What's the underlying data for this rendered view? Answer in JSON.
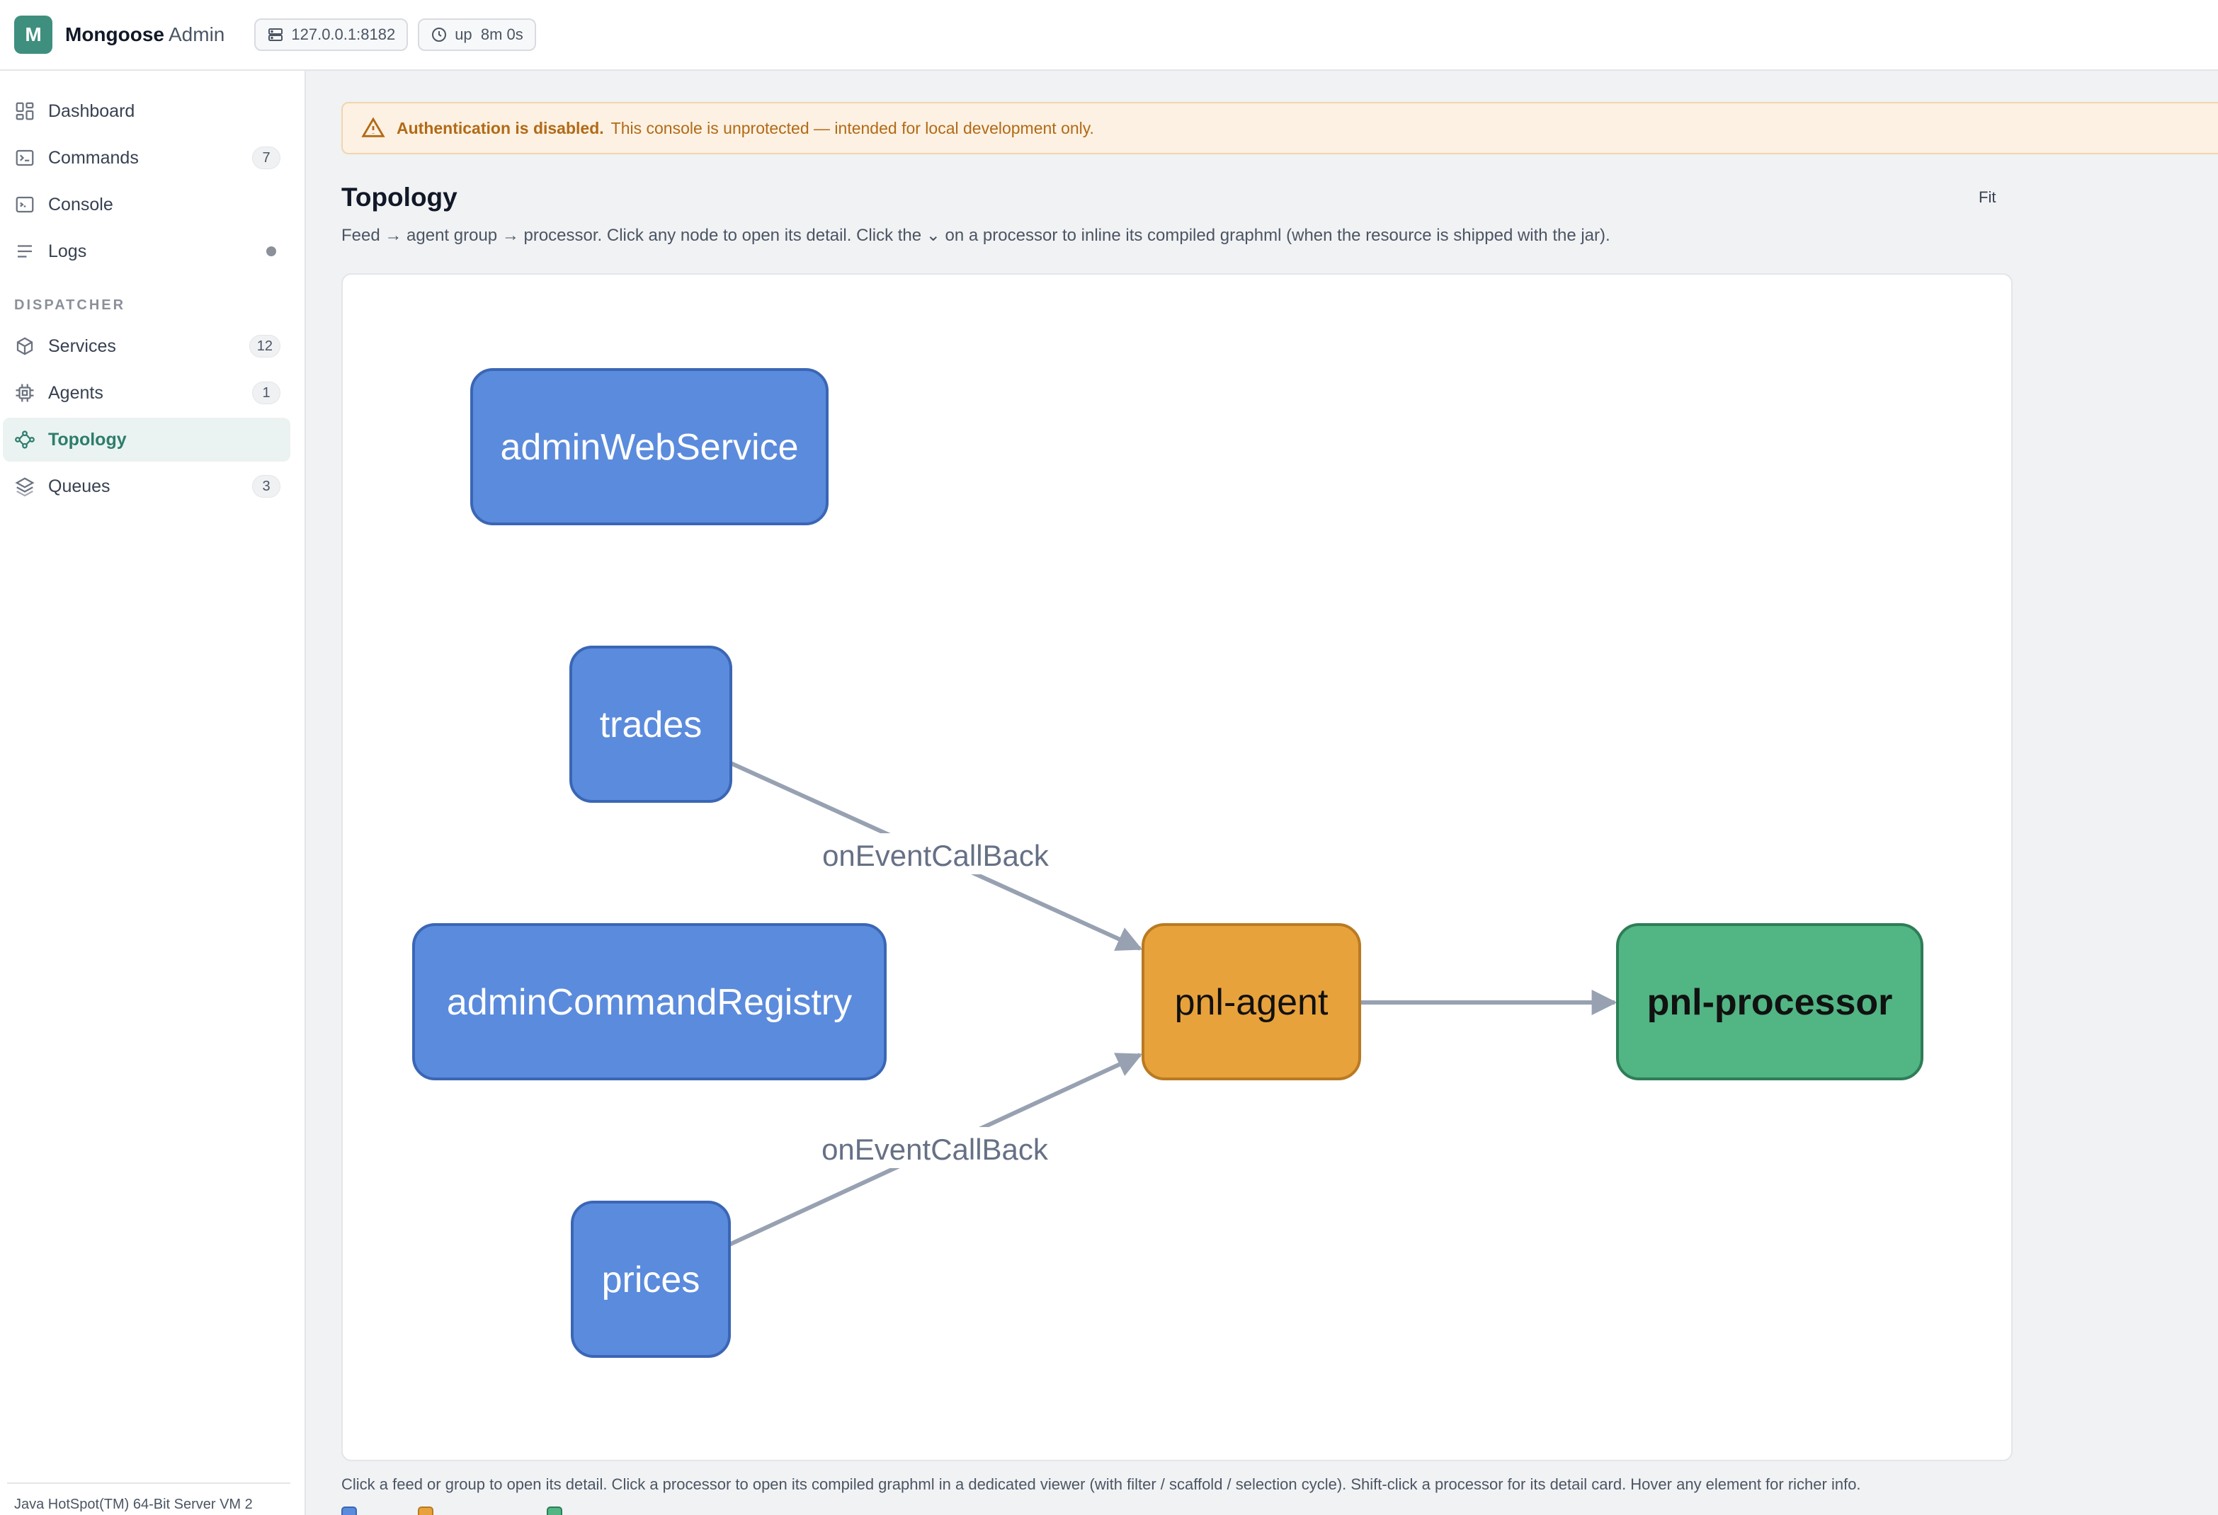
{
  "app": {
    "logo_letter": "M",
    "name": "Mongoose",
    "name_suffix": "Admin",
    "host": "127.0.0.1:8182",
    "uptime": "up  8m 0s"
  },
  "sidebar": {
    "items": [
      {
        "label": "Dashboard",
        "icon": "dashboard-icon"
      },
      {
        "label": "Commands",
        "icon": "terminal-icon",
        "count": "7"
      },
      {
        "label": "Console",
        "icon": "console-icon"
      },
      {
        "label": "Logs",
        "icon": "lines-icon"
      }
    ],
    "section": "DISPATCHER",
    "dispatcher_items": [
      {
        "label": "Services",
        "icon": "cube-icon",
        "count": "12"
      },
      {
        "label": "Agents",
        "icon": "cpu-icon",
        "count": "1"
      },
      {
        "label": "Topology",
        "icon": "topology-icon",
        "active": true
      },
      {
        "label": "Queues",
        "icon": "layers-icon",
        "count": "3"
      }
    ],
    "footer": "Java HotSpot(TM) 64-Bit Server VM 2"
  },
  "banner": {
    "strong": "Authentication is disabled.",
    "text": "This console is unprotected — intended for local development only."
  },
  "page": {
    "title": "Topology",
    "fit_label": "Fit",
    "subtitle": "Feed → agent group → processor. Click any node to open its detail. Click the ⌄ on a processor to inline its compiled graphml (when the resource is shipped with the jar)."
  },
  "graph": {
    "nodes": [
      {
        "id": "adminWebService",
        "label": "adminWebService",
        "kind": "feed"
      },
      {
        "id": "trades",
        "label": "trades",
        "kind": "feed"
      },
      {
        "id": "adminCommandRegistry",
        "label": "adminCommandRegistry",
        "kind": "feed"
      },
      {
        "id": "prices",
        "label": "prices",
        "kind": "feed"
      },
      {
        "id": "pnl-agent",
        "label": "pnl-agent",
        "kind": "agent"
      },
      {
        "id": "pnl-processor",
        "label": "pnl-processor",
        "kind": "processor"
      }
    ],
    "edges": [
      {
        "from": "trades",
        "to": "pnl-agent",
        "label": "onEventCallBack"
      },
      {
        "from": "prices",
        "to": "pnl-agent",
        "label": "onEventCallBack"
      },
      {
        "from": "pnl-agent",
        "to": "pnl-processor",
        "label": ""
      }
    ],
    "colors": {
      "feed": "#5b8bdc",
      "feed_border": "#3b66b5",
      "agent": "#e8a23c",
      "agent_border": "#b97a22",
      "processor": "#52b584",
      "processor_border": "#2e7d57",
      "edge": "#97a1b1"
    }
  },
  "footer": {
    "help": "Click a feed or group to open its detail. Click a processor to open its compiled graphml in a dedicated viewer (with filter / scaffold / selection cycle). Shift-click a processor for its detail card. Hover any element for richer info."
  }
}
